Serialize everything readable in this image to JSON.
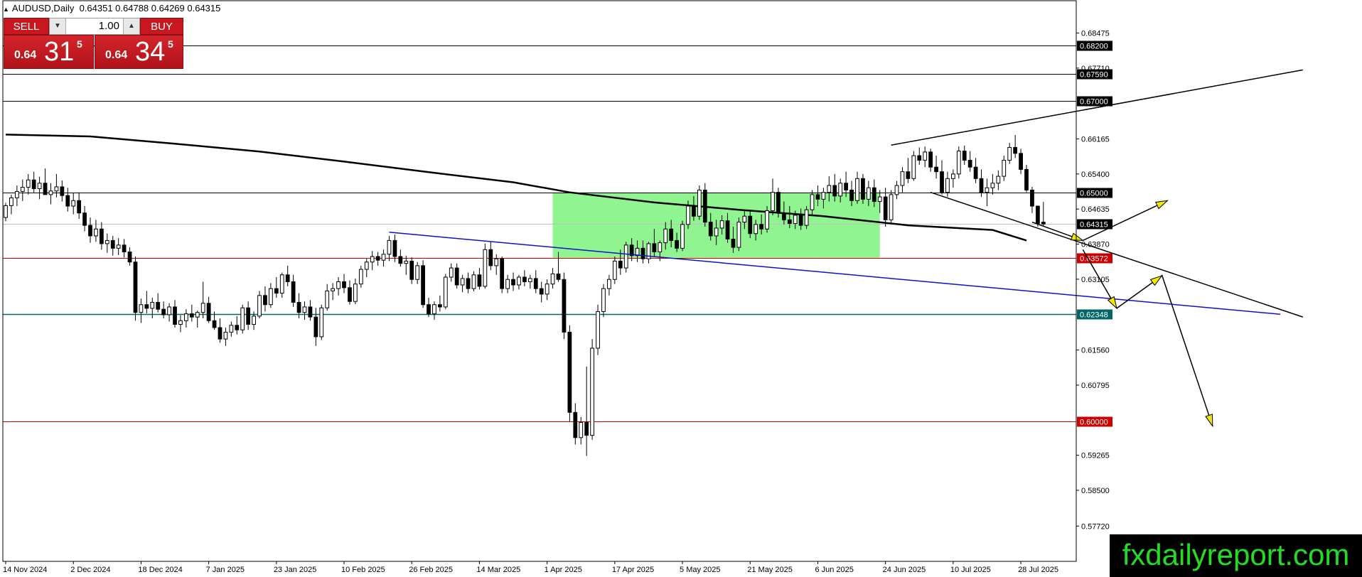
{
  "header": {
    "symbol_timeframe": "AUDUSD,Daily",
    "ohlc": "0.64351 0.64788 0.64269 0.64315"
  },
  "trade_panel": {
    "sell_label": "SELL",
    "buy_label": "BUY",
    "lot": "1.00",
    "sell_price": {
      "small": "0.64",
      "big": "31",
      "sup": "5"
    },
    "buy_price": {
      "small": "0.64",
      "big": "34",
      "sup": "5"
    }
  },
  "watermark": "fxdailyreport.com",
  "colors": {
    "bg": "#ffffff",
    "axis": "#000000",
    "red_line": "#cc0000",
    "teal_line": "#006666",
    "blue_line": "#1010cc",
    "zone": "#90f590",
    "ma": "#000000",
    "arrow_fill": "#f2e600"
  },
  "chart_data": {
    "type": "candlestick",
    "y_axis": {
      "min": 0.5695,
      "max": 0.6918,
      "ticks": [
        "0.68475",
        "0.67710",
        "0.66165",
        "0.65400",
        "0.64635",
        "0.63870",
        "0.63105",
        "0.61560",
        "0.60795",
        "0.59265",
        "0.58500",
        "0.57720"
      ]
    },
    "x_axis": {
      "labels": [
        {
          "text": "14 Nov 2024",
          "i": 0
        },
        {
          "text": "2 Dec 2024",
          "i": 12
        },
        {
          "text": "18 Dec 2024",
          "i": 24
        },
        {
          "text": "7 Jan 2025",
          "i": 36
        },
        {
          "text": "23 Jan 2025",
          "i": 48
        },
        {
          "text": "10 Feb 2025",
          "i": 60
        },
        {
          "text": "26 Feb 2025",
          "i": 72
        },
        {
          "text": "14 Mar 2025",
          "i": 84
        },
        {
          "text": "1 Apr 2025",
          "i": 96
        },
        {
          "text": "17 Apr 2025",
          "i": 108
        },
        {
          "text": "5 May 2025",
          "i": 120
        },
        {
          "text": "21 May 2025",
          "i": 132
        },
        {
          "text": "6 Jun 2025",
          "i": 144
        },
        {
          "text": "24 Jun 2025",
          "i": 156
        },
        {
          "text": "10 Jul 2025",
          "i": 168
        },
        {
          "text": "28 Jul 2025",
          "i": 180
        }
      ],
      "future_bars": 50
    },
    "candles": [
      [
        0.6445,
        0.6477,
        0.6437,
        0.6471
      ],
      [
        0.6471,
        0.6495,
        0.6452,
        0.6488
      ],
      [
        0.6488,
        0.6515,
        0.647,
        0.6502
      ],
      [
        0.6502,
        0.6528,
        0.6481,
        0.6511
      ],
      [
        0.6511,
        0.654,
        0.6495,
        0.6527
      ],
      [
        0.6527,
        0.6545,
        0.6499,
        0.6508
      ],
      [
        0.6508,
        0.6534,
        0.6485,
        0.652
      ],
      [
        0.652,
        0.6552,
        0.6505,
        0.6495
      ],
      [
        0.6495,
        0.652,
        0.6474,
        0.6503
      ],
      [
        0.6503,
        0.654,
        0.6489,
        0.6512
      ],
      [
        0.6512,
        0.6526,
        0.648,
        0.6493
      ],
      [
        0.6493,
        0.651,
        0.6458,
        0.647
      ],
      [
        0.647,
        0.6498,
        0.6452,
        0.6482
      ],
      [
        0.6482,
        0.65,
        0.6442,
        0.6455
      ],
      [
        0.6455,
        0.647,
        0.6415,
        0.6428
      ],
      [
        0.6428,
        0.6445,
        0.639,
        0.6405
      ],
      [
        0.6405,
        0.644,
        0.6392,
        0.642
      ],
      [
        0.642,
        0.6435,
        0.6375,
        0.6388
      ],
      [
        0.6388,
        0.641,
        0.6368,
        0.6395
      ],
      [
        0.6395,
        0.6405,
        0.6362,
        0.6378
      ],
      [
        0.6378,
        0.64,
        0.6363,
        0.6385
      ],
      [
        0.6385,
        0.6398,
        0.6358,
        0.637
      ],
      [
        0.637,
        0.638,
        0.634,
        0.6348
      ],
      [
        0.6348,
        0.636,
        0.622,
        0.6238
      ],
      [
        0.6238,
        0.6268,
        0.6215,
        0.6255
      ],
      [
        0.6255,
        0.6285,
        0.6236,
        0.6247
      ],
      [
        0.6247,
        0.627,
        0.6225,
        0.626
      ],
      [
        0.626,
        0.628,
        0.6238,
        0.6245
      ],
      [
        0.6245,
        0.6262,
        0.6225,
        0.6233
      ],
      [
        0.6233,
        0.6258,
        0.6218,
        0.625
      ],
      [
        0.625,
        0.6265,
        0.6205,
        0.6212
      ],
      [
        0.6212,
        0.6232,
        0.6195,
        0.622
      ],
      [
        0.622,
        0.6245,
        0.6205,
        0.6235
      ],
      [
        0.6235,
        0.6255,
        0.6218,
        0.6228
      ],
      [
        0.6228,
        0.6242,
        0.6205,
        0.6238
      ],
      [
        0.6238,
        0.6305,
        0.6225,
        0.6258
      ],
      [
        0.6258,
        0.6272,
        0.6215,
        0.622
      ],
      [
        0.622,
        0.624,
        0.62,
        0.6205
      ],
      [
        0.6205,
        0.6225,
        0.6172,
        0.618
      ],
      [
        0.618,
        0.6205,
        0.6165,
        0.6195
      ],
      [
        0.6195,
        0.6218,
        0.6185,
        0.621
      ],
      [
        0.621,
        0.623,
        0.619,
        0.62
      ],
      [
        0.62,
        0.6255,
        0.6192,
        0.6248
      ],
      [
        0.6248,
        0.6262,
        0.62,
        0.6212
      ],
      [
        0.6212,
        0.624,
        0.62,
        0.623
      ],
      [
        0.623,
        0.6285,
        0.6225,
        0.6275
      ],
      [
        0.6275,
        0.6295,
        0.624,
        0.6255
      ],
      [
        0.6255,
        0.6302,
        0.6248,
        0.629
      ],
      [
        0.629,
        0.6315,
        0.627,
        0.628
      ],
      [
        0.628,
        0.6325,
        0.627,
        0.632
      ],
      [
        0.632,
        0.634,
        0.6295,
        0.6305
      ],
      [
        0.6305,
        0.632,
        0.625,
        0.626
      ],
      [
        0.626,
        0.628,
        0.6225,
        0.6238
      ],
      [
        0.6238,
        0.6262,
        0.6222,
        0.625
      ],
      [
        0.625,
        0.6265,
        0.622,
        0.6228
      ],
      [
        0.6228,
        0.6248,
        0.6165,
        0.6185
      ],
      [
        0.6185,
        0.6255,
        0.6178,
        0.6248
      ],
      [
        0.6248,
        0.63,
        0.6242,
        0.6285
      ],
      [
        0.6285,
        0.6302,
        0.6265,
        0.629
      ],
      [
        0.629,
        0.6315,
        0.6275,
        0.6305
      ],
      [
        0.6305,
        0.6322,
        0.628,
        0.6292
      ],
      [
        0.6292,
        0.6308,
        0.6255,
        0.6262
      ],
      [
        0.6262,
        0.6312,
        0.6256,
        0.63
      ],
      [
        0.63,
        0.634,
        0.6292,
        0.6332
      ],
      [
        0.6332,
        0.6355,
        0.6315,
        0.6348
      ],
      [
        0.6348,
        0.6372,
        0.633,
        0.636
      ],
      [
        0.636,
        0.637,
        0.634,
        0.6352
      ],
      [
        0.6352,
        0.6375,
        0.6338,
        0.6365
      ],
      [
        0.6365,
        0.6405,
        0.635,
        0.6395
      ],
      [
        0.6395,
        0.6408,
        0.6348,
        0.636
      ],
      [
        0.636,
        0.6375,
        0.6338,
        0.6345
      ],
      [
        0.6345,
        0.6362,
        0.632,
        0.635
      ],
      [
        0.635,
        0.6358,
        0.63,
        0.631
      ],
      [
        0.631,
        0.6348,
        0.63,
        0.634
      ],
      [
        0.634,
        0.6352,
        0.6248,
        0.6255
      ],
      [
        0.6255,
        0.627,
        0.6228,
        0.6235
      ],
      [
        0.6235,
        0.6262,
        0.6222,
        0.6255
      ],
      [
        0.6255,
        0.6275,
        0.624,
        0.625
      ],
      [
        0.625,
        0.6322,
        0.6245,
        0.6315
      ],
      [
        0.6315,
        0.6345,
        0.6305,
        0.6335
      ],
      [
        0.6335,
        0.6345,
        0.629,
        0.6298
      ],
      [
        0.6298,
        0.632,
        0.6282,
        0.6312
      ],
      [
        0.6312,
        0.6325,
        0.628,
        0.629
      ],
      [
        0.629,
        0.6328,
        0.6284,
        0.632
      ],
      [
        0.632,
        0.6335,
        0.6288,
        0.6295
      ],
      [
        0.6295,
        0.6388,
        0.629,
        0.6375
      ],
      [
        0.6375,
        0.6392,
        0.633,
        0.634
      ],
      [
        0.634,
        0.6365,
        0.632,
        0.6355
      ],
      [
        0.6355,
        0.636,
        0.628,
        0.629
      ],
      [
        0.629,
        0.632,
        0.628,
        0.631
      ],
      [
        0.631,
        0.6325,
        0.6285,
        0.6298
      ],
      [
        0.6298,
        0.632,
        0.6288,
        0.6315
      ],
      [
        0.6315,
        0.633,
        0.6295,
        0.6305
      ],
      [
        0.6305,
        0.632,
        0.629,
        0.6312
      ],
      [
        0.6312,
        0.633,
        0.628,
        0.629
      ],
      [
        0.629,
        0.6305,
        0.626,
        0.6278
      ],
      [
        0.6278,
        0.631,
        0.6265,
        0.63
      ],
      [
        0.63,
        0.6335,
        0.629,
        0.6322
      ],
      [
        0.6322,
        0.637,
        0.6305,
        0.631
      ],
      [
        0.631,
        0.6325,
        0.618,
        0.6195
      ],
      [
        0.6195,
        0.621,
        0.6,
        0.602
      ],
      [
        0.602,
        0.604,
        0.595,
        0.5965
      ],
      [
        0.5965,
        0.601,
        0.595,
        0.5998
      ],
      [
        0.5998,
        0.612,
        0.5925,
        0.597
      ],
      [
        0.597,
        0.618,
        0.596,
        0.616
      ],
      [
        0.616,
        0.6255,
        0.6145,
        0.624
      ],
      [
        0.624,
        0.63,
        0.6228,
        0.629
      ],
      [
        0.629,
        0.632,
        0.6275,
        0.631
      ],
      [
        0.631,
        0.636,
        0.63,
        0.635
      ],
      [
        0.635,
        0.6375,
        0.632,
        0.6335
      ],
      [
        0.6335,
        0.6392,
        0.6325,
        0.6385
      ],
      [
        0.6385,
        0.64,
        0.635,
        0.6362
      ],
      [
        0.6362,
        0.6395,
        0.6348,
        0.6378
      ],
      [
        0.6378,
        0.6395,
        0.6345,
        0.6355
      ],
      [
        0.6355,
        0.6392,
        0.6345,
        0.6388
      ],
      [
        0.6388,
        0.642,
        0.636,
        0.637
      ],
      [
        0.637,
        0.6395,
        0.635,
        0.639
      ],
      [
        0.639,
        0.6435,
        0.6375,
        0.642
      ],
      [
        0.642,
        0.644,
        0.638,
        0.6395
      ],
      [
        0.6395,
        0.6412,
        0.637,
        0.6378
      ],
      [
        0.6378,
        0.6438,
        0.6372,
        0.643
      ],
      [
        0.643,
        0.6482,
        0.642,
        0.647
      ],
      [
        0.647,
        0.6492,
        0.6438,
        0.6448
      ],
      [
        0.6448,
        0.6515,
        0.644,
        0.6505
      ],
      [
        0.6505,
        0.652,
        0.6425,
        0.6435
      ],
      [
        0.6435,
        0.6455,
        0.6395,
        0.6405
      ],
      [
        0.6405,
        0.644,
        0.6385,
        0.6422
      ],
      [
        0.6422,
        0.645,
        0.6408,
        0.6438
      ],
      [
        0.6438,
        0.6455,
        0.639,
        0.6398
      ],
      [
        0.6398,
        0.6425,
        0.6368,
        0.638
      ],
      [
        0.638,
        0.6445,
        0.6372,
        0.6435
      ],
      [
        0.6435,
        0.646,
        0.642,
        0.6448
      ],
      [
        0.6448,
        0.6462,
        0.64,
        0.641
      ],
      [
        0.641,
        0.644,
        0.6395,
        0.643
      ],
      [
        0.643,
        0.6452,
        0.6408,
        0.642
      ],
      [
        0.642,
        0.647,
        0.6412,
        0.646
      ],
      [
        0.646,
        0.653,
        0.645,
        0.65
      ],
      [
        0.65,
        0.651,
        0.6445,
        0.6455
      ],
      [
        0.6455,
        0.648,
        0.643,
        0.644
      ],
      [
        0.644,
        0.647,
        0.6422,
        0.6432
      ],
      [
        0.6432,
        0.646,
        0.642,
        0.645
      ],
      [
        0.645,
        0.6465,
        0.6418,
        0.6428
      ],
      [
        0.6428,
        0.647,
        0.642,
        0.6462
      ],
      [
        0.6462,
        0.6505,
        0.645,
        0.6495
      ],
      [
        0.6495,
        0.6515,
        0.647,
        0.6485
      ],
      [
        0.6485,
        0.651,
        0.6465,
        0.65
      ],
      [
        0.65,
        0.6535,
        0.648,
        0.6515
      ],
      [
        0.6515,
        0.654,
        0.648,
        0.6492
      ],
      [
        0.6492,
        0.653,
        0.6478,
        0.652
      ],
      [
        0.652,
        0.6545,
        0.649,
        0.6505
      ],
      [
        0.6505,
        0.6525,
        0.647,
        0.6482
      ],
      [
        0.6482,
        0.6545,
        0.6475,
        0.653
      ],
      [
        0.653,
        0.654,
        0.6475,
        0.6485
      ],
      [
        0.6485,
        0.6525,
        0.647,
        0.651
      ],
      [
        0.651,
        0.6528,
        0.6468,
        0.648
      ],
      [
        0.648,
        0.6505,
        0.6455,
        0.649
      ],
      [
        0.649,
        0.651,
        0.6425,
        0.644
      ],
      [
        0.644,
        0.6505,
        0.643,
        0.6495
      ],
      [
        0.6495,
        0.6525,
        0.6485,
        0.6515
      ],
      [
        0.6515,
        0.6555,
        0.65,
        0.6545
      ],
      [
        0.6545,
        0.6575,
        0.652,
        0.653
      ],
      [
        0.653,
        0.659,
        0.6525,
        0.658
      ],
      [
        0.658,
        0.6598,
        0.656,
        0.657
      ],
      [
        0.657,
        0.66,
        0.6555,
        0.6588
      ],
      [
        0.6588,
        0.6595,
        0.6545,
        0.6555
      ],
      [
        0.6555,
        0.658,
        0.653,
        0.6545
      ],
      [
        0.6545,
        0.657,
        0.6495,
        0.65
      ],
      [
        0.65,
        0.6545,
        0.649,
        0.653
      ],
      [
        0.653,
        0.655,
        0.651,
        0.654
      ],
      [
        0.654,
        0.66,
        0.653,
        0.659
      ],
      [
        0.659,
        0.6602,
        0.656,
        0.657
      ],
      [
        0.657,
        0.659,
        0.6545,
        0.6555
      ],
      [
        0.6555,
        0.6575,
        0.652,
        0.653
      ],
      [
        0.653,
        0.655,
        0.649,
        0.65
      ],
      [
        0.65,
        0.653,
        0.647,
        0.651
      ],
      [
        0.651,
        0.654,
        0.6495,
        0.652
      ],
      [
        0.652,
        0.6548,
        0.6505,
        0.6535
      ],
      [
        0.6535,
        0.658,
        0.6525,
        0.657
      ],
      [
        0.657,
        0.6608,
        0.6562,
        0.6598
      ],
      [
        0.6598,
        0.6625,
        0.6575,
        0.6585
      ],
      [
        0.6585,
        0.6595,
        0.654,
        0.655
      ],
      [
        0.655,
        0.656,
        0.65,
        0.6505
      ],
      [
        0.6505,
        0.6512,
        0.6455,
        0.647
      ],
      [
        0.647,
        0.647,
        0.6425,
        0.6432
      ],
      [
        0.6435,
        0.6479,
        0.6427,
        0.6431
      ]
    ],
    "moving_average": [
      {
        "i": 0,
        "v": 0.6626
      },
      {
        "i": 15,
        "v": 0.6622
      },
      {
        "i": 30,
        "v": 0.6606
      },
      {
        "i": 45,
        "v": 0.6589
      },
      {
        "i": 60,
        "v": 0.6567
      },
      {
        "i": 75,
        "v": 0.6544
      },
      {
        "i": 90,
        "v": 0.6522
      },
      {
        "i": 100,
        "v": 0.65
      },
      {
        "i": 115,
        "v": 0.6478
      },
      {
        "i": 130,
        "v": 0.6462
      },
      {
        "i": 145,
        "v": 0.6448
      },
      {
        "i": 160,
        "v": 0.6428
      },
      {
        "i": 175,
        "v": 0.6418
      },
      {
        "i": 181,
        "v": 0.6395
      }
    ],
    "zone": {
      "i0": 97,
      "i1": 155,
      "top": 0.65,
      "bottom": 0.6357
    },
    "horizontal_lines": [
      {
        "price": 0.682,
        "label": "0.68200",
        "style": "black"
      },
      {
        "price": 0.6759,
        "label": "0.67590",
        "style": "black"
      },
      {
        "price": 0.67,
        "label": "0.67000",
        "style": "black"
      },
      {
        "price": 0.65,
        "label": "0.65000",
        "style": "black"
      },
      {
        "price": 0.64315,
        "label": "0.64315",
        "style": "current"
      },
      {
        "price": 0.63572,
        "label": "0.63572",
        "style": "red"
      },
      {
        "price": 0.62348,
        "label": "0.62348",
        "style": "teal"
      },
      {
        "price": 0.6,
        "label": "0.60000",
        "style": "red"
      }
    ],
    "trendlines": [
      {
        "i0": 157,
        "p0": 0.6603,
        "i1": 230,
        "p1": 0.6767,
        "color": "black"
      },
      {
        "i0": 164,
        "p0": 0.65,
        "i1": 230,
        "p1": 0.6228,
        "color": "black"
      },
      {
        "i0": 68,
        "p0": 0.6413,
        "i1": 226,
        "p1": 0.6234,
        "color": "blue"
      }
    ],
    "projection_arrows": [
      [
        {
          "i": 182,
          "p": 0.6435
        },
        {
          "i": 191,
          "p": 0.6395
        },
        {
          "i": 206,
          "p": 0.6482
        }
      ],
      [
        {
          "i": 191,
          "p": 0.6375
        },
        {
          "i": 197,
          "p": 0.6247
        },
        {
          "i": 205,
          "p": 0.6318
        }
      ],
      [
        {
          "i": 205,
          "p": 0.632
        },
        {
          "i": 214,
          "p": 0.599
        }
      ]
    ]
  }
}
